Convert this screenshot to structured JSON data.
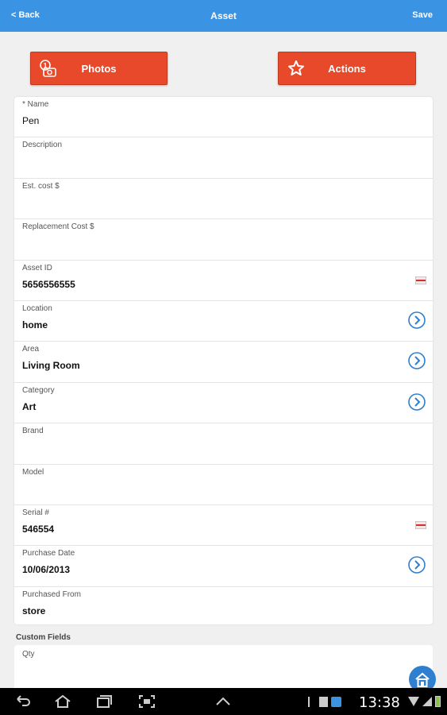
{
  "header": {
    "back_label": "< Back",
    "title": "Asset",
    "save_label": "Save"
  },
  "buttons": {
    "photos_label": "Photos",
    "photos_badge": "1",
    "actions_label": "Actions"
  },
  "fields": [
    {
      "label": "* Name",
      "value": "Pen",
      "accessory": "none"
    },
    {
      "label": "Description",
      "value": "",
      "accessory": "none"
    },
    {
      "label": "Est. cost $",
      "value": "",
      "accessory": "none"
    },
    {
      "label": "Replacement Cost $",
      "value": "",
      "accessory": "none"
    },
    {
      "label": "Asset ID",
      "value": "5656556555",
      "accessory": "barcode-scan"
    },
    {
      "label": "Location",
      "value": "home",
      "accessory": "chevron"
    },
    {
      "label": "Area",
      "value": "Living Room",
      "accessory": "chevron"
    },
    {
      "label": "Category",
      "value": "Art",
      "accessory": "chevron"
    },
    {
      "label": "Brand",
      "value": "",
      "accessory": "none"
    },
    {
      "label": "Model",
      "value": "",
      "accessory": "none"
    },
    {
      "label": "Serial #",
      "value": "546554",
      "accessory": "barcode-scan"
    },
    {
      "label": "Purchase Date",
      "value": "10/06/2013",
      "accessory": "chevron"
    },
    {
      "label": "Purchased From",
      "value": "store",
      "accessory": "none"
    }
  ],
  "custom_fields": {
    "title": "Custom Fields",
    "first_label": "Qty"
  },
  "system_bar": {
    "clock": "13:38"
  },
  "colors": {
    "header": "#3b93e3",
    "button": "#e8492a",
    "chevron": "#2f7fd0"
  }
}
